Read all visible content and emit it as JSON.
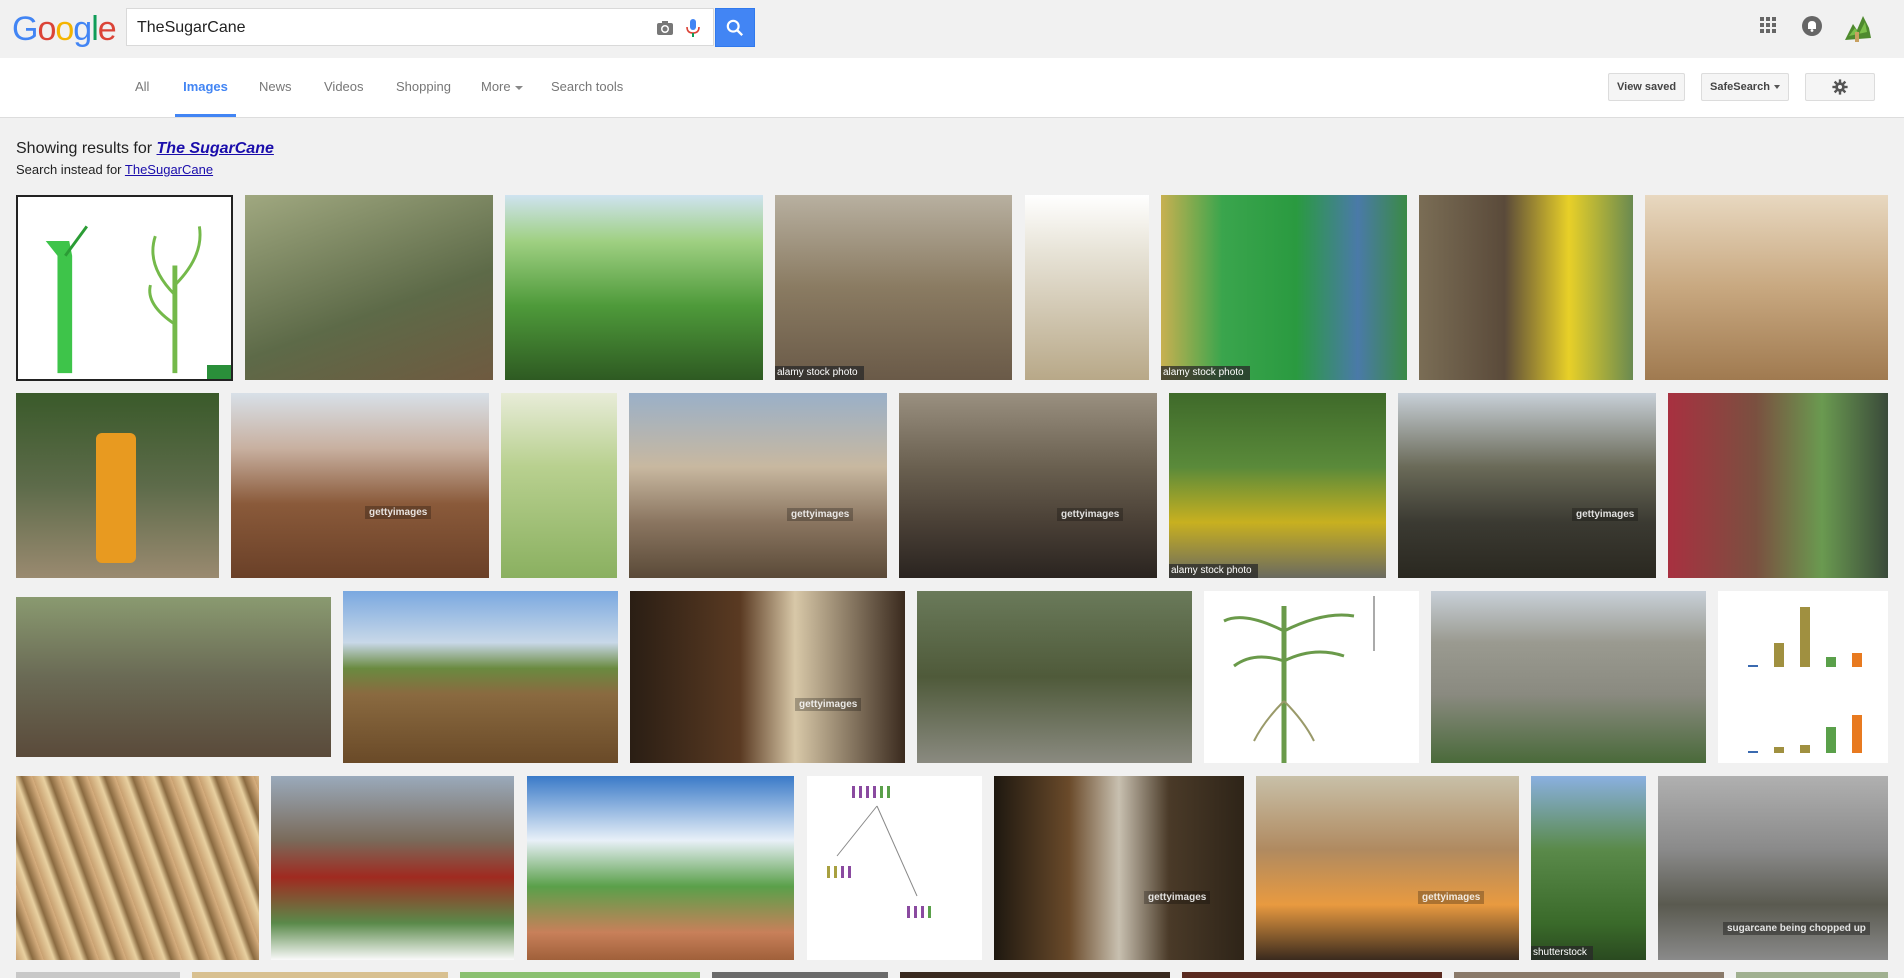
{
  "header": {
    "logo_letters": [
      "G",
      "o",
      "o",
      "g",
      "l",
      "e"
    ],
    "search": {
      "value": "TheSugarCane",
      "placeholder": ""
    }
  },
  "nav": {
    "tabs": [
      {
        "label": "All"
      },
      {
        "label": "Images",
        "active": true
      },
      {
        "label": "News"
      },
      {
        "label": "Videos"
      },
      {
        "label": "Shopping"
      },
      {
        "label": "More"
      },
      {
        "label": "Search tools"
      }
    ],
    "view_saved": "View saved",
    "safesearch": "SafeSearch"
  },
  "results": {
    "showing_prefix": "Showing results for",
    "corrected_query": "The SugarCane",
    "instead_prefix": "Search instead for",
    "original_query": "TheSugarCane"
  },
  "badges": {
    "alamy": "alamy stock photo",
    "getty": "gettyimages",
    "shutterstock": "shutterstock",
    "sugarcane_caption": "sugarcane being chopped up"
  },
  "thumbnails": {
    "row1": [
      "#9fd89a",
      "#6f7a55",
      "#5ea64a",
      "#8a7b62",
      "#c8c0a8",
      "#3aa54d",
      "#7a6d55",
      "#b89a78"
    ],
    "row2": [
      "#5d6b4a",
      "#8a5a3a",
      "#b8d08f",
      "#8a7560",
      "#4a4036",
      "#3f6a2a",
      "#3b3a32",
      "#7a5040"
    ],
    "row3": [
      "#6a6a55",
      "#8a6a40",
      "#3a2a1e",
      "#4f5a3a",
      "#f4f4f4",
      "#8a8a80",
      "#fbfbfb"
    ],
    "row4": [
      "#c8a070",
      "#7a6a5a",
      "#6a9cc8",
      "#fafafa",
      "#2e2418",
      "#b08a60",
      "#5a8a4a",
      "#8a8a8a"
    ],
    "row5": [
      "#c8c8c8",
      "#d8c090",
      "#8ac070",
      "#6a6a6a",
      "#3a2a20",
      "#5a2a20",
      "#8a7a6a",
      "#a0b090"
    ]
  }
}
